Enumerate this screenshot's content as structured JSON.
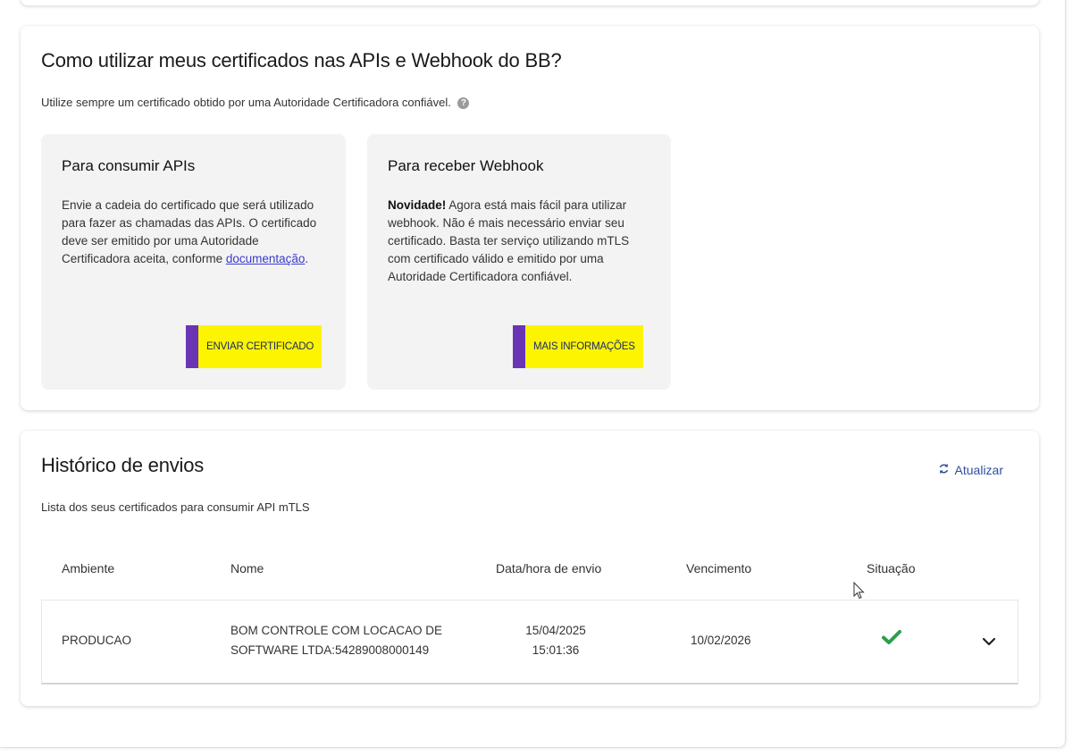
{
  "usage": {
    "title": "Como utilizar meus certificados nas APIs e Webhook do BB?",
    "subtitle": "Utilize sempre um certificado obtido por uma Autoridade Certificadora confiável.",
    "help_icon_glyph": "?",
    "consume": {
      "title": "Para consumir APIs",
      "text": "Envie a cadeia do certificado que será utilizado para fazer as chamadas das APIs. O certificado deve ser emitido por uma Autoridade Certificadora aceita, conforme ",
      "link": "documentação",
      "text_end": ".",
      "button": "ENVIAR CERTIFICADO"
    },
    "webhook": {
      "title": "Para receber Webhook",
      "bold": "Novidade!",
      "text": " Agora está mais fácil para utilizar webhook. Não é mais necessário enviar seu certificado. Basta ter serviço utilizando mTLS com certificado válido e emitido por uma Autoridade Certificadora confiável.",
      "button": "MAIS INFORMAÇÕES"
    }
  },
  "history": {
    "title": "Histórico de envios",
    "subtitle": "Lista dos seus certificados para consumir API mTLS",
    "refresh_label": "Atualizar",
    "columns": [
      "Ambiente",
      "Nome",
      "Data/hora de envio",
      "Vencimento",
      "Situação"
    ],
    "rows": [
      {
        "ambiente": "PRODUCAO",
        "nome_line1": "BOM CONTROLE COM LOCACAO DE",
        "nome_line2": "SOFTWARE LTDA:54289008000149",
        "data": "15/04/2025",
        "hora": "15:01:36",
        "vencimento": "10/02/2026",
        "situacao_icon": "check-icon"
      }
    ]
  },
  "colors": {
    "accent_yellow": "#fcf400",
    "accent_purple": "#6a35b5",
    "link_blue": "#2f4f9c",
    "status_green": "#2e9e4f"
  }
}
